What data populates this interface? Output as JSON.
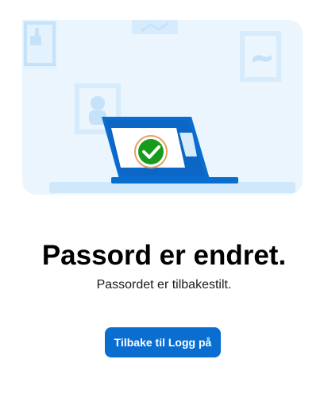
{
  "illustration": {
    "icon": "laptop-success-checkmark-icon",
    "colors": {
      "background": "#eaf5fe",
      "laptop": "#0a6ed1",
      "screen": "#ffffff",
      "check": "#189a1c",
      "frames": "#d6ecfc"
    }
  },
  "title": "Passord er endret.",
  "subtitle": "Passordet er tilbakestilt.",
  "back_button": {
    "label": "Tilbake til Logg på",
    "color": "#0a6ed1"
  }
}
